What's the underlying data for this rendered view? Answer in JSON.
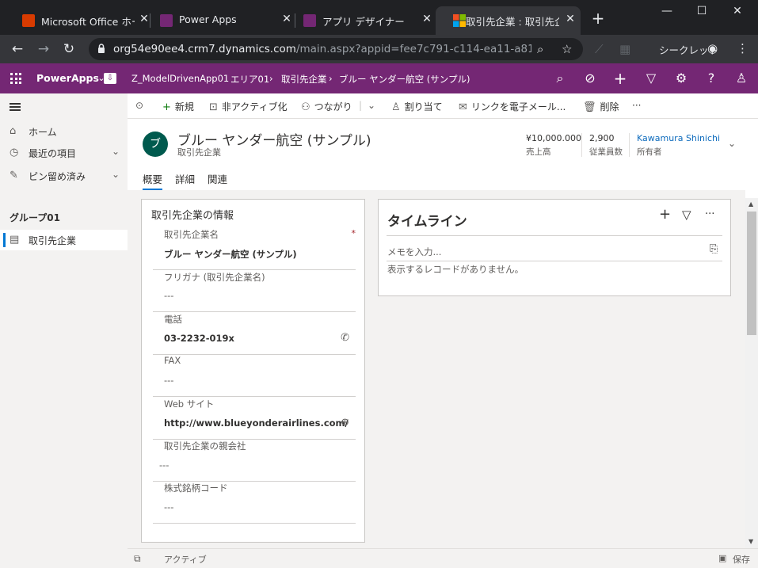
{
  "browser": {
    "tabs": [
      {
        "title": "Microsoft Office ホーム",
        "color": "#d83b01"
      },
      {
        "title": "Power Apps",
        "color": "#742774"
      },
      {
        "title": "アプリ デザイナー",
        "color": "#742774"
      },
      {
        "title": "取引先企業 : 取引先企",
        "color": "#0078d4"
      }
    ],
    "url_host": "org54e90ee4.crm7.dynamics.com",
    "url_path": "/main.aspx?appid=fee7c791-c114-ea11-a811-00...",
    "incognito_label": "シークレット"
  },
  "app_header": {
    "brand": "PowerApps",
    "app_name": "Z_ModelDrivenApp01",
    "area": "エリア01",
    "breadcrumb_entity": "取引先企業",
    "breadcrumb_record": "ブルー ヤンダー航空 (サンプル)"
  },
  "commands": {
    "new": "新規",
    "deactivate": "非アクティブ化",
    "connect": "つながり",
    "assign": "割り当て",
    "email_link": "リンクを電子メール...",
    "delete": "削除",
    "more": "···"
  },
  "nav": {
    "home": "ホーム",
    "recent": "最近の項目",
    "pinned": "ピン留め済み",
    "group": "グループ01",
    "entity": "取引先企業"
  },
  "record": {
    "avatar_letter": "ブ",
    "title": "ブルー ヤンダー航空 (サンプル)",
    "entity": "取引先企業",
    "revenue_value": "¥10,000.000",
    "revenue_label": "売上高",
    "employees_value": "2,900",
    "employees_label": "従業員数",
    "owner_value": "Kawamura Shinichi",
    "owner_label": "所有者"
  },
  "form_tabs": {
    "summary": "概要",
    "details": "詳細",
    "related": "関連"
  },
  "section": {
    "title": "取引先企業の情報",
    "fields": [
      {
        "label": "取引先企業名",
        "value": "ブルー ヤンダー航空 (サンプル)",
        "required": "*"
      },
      {
        "label": "フリガナ (取引先企業名)",
        "value": "---"
      },
      {
        "label": "電話",
        "value": "03-2232-019x"
      },
      {
        "label": "FAX",
        "value": "---"
      },
      {
        "label": "Web サイト",
        "value": "http://www.blueyonderairlines.com/"
      },
      {
        "label": "取引先企業の親会社",
        "value": "---"
      },
      {
        "label": "株式銘柄コード",
        "value": "---"
      }
    ]
  },
  "timeline": {
    "title": "タイムライン",
    "note_placeholder": "メモを入力...",
    "empty_text": "表示するレコードがありません。"
  },
  "status": {
    "state": "アクティブ",
    "save": "保存"
  }
}
